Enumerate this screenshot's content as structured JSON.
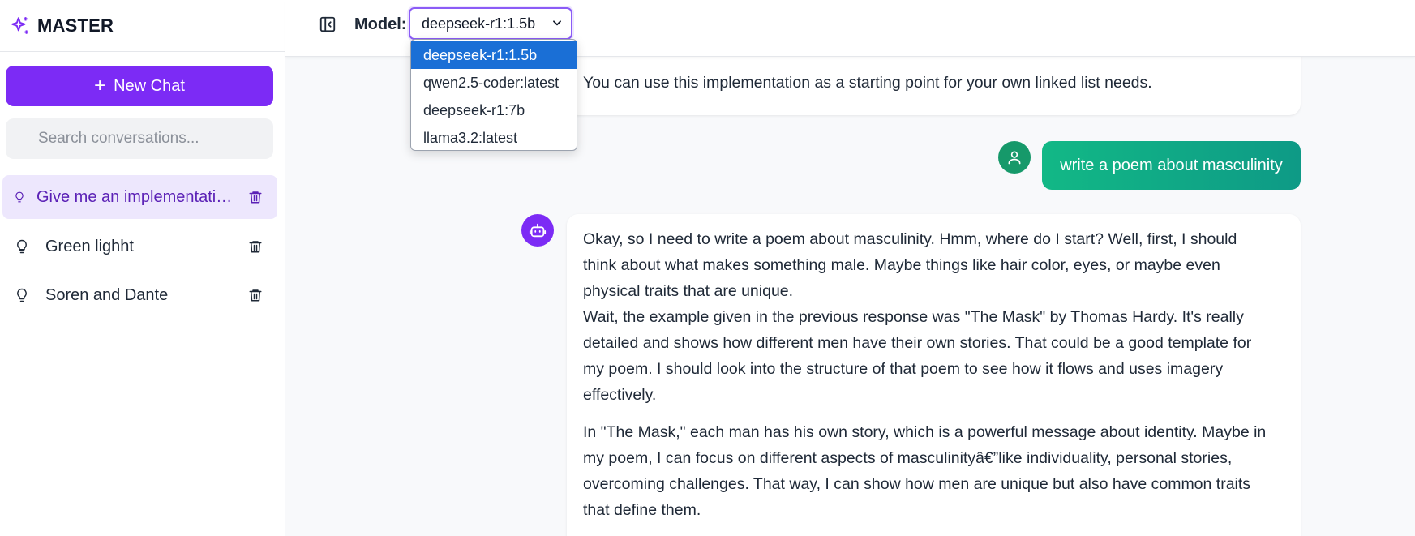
{
  "app": {
    "title": "MASTER",
    "colors": {
      "accent": "#7c2bf5",
      "user_bubble": "#12b886",
      "selected_option": "#1a6fd6"
    }
  },
  "sidebar": {
    "new_chat_label": "New Chat",
    "search_placeholder": "Search conversations...",
    "conversations": [
      {
        "label": "Give me an implementation of a linked list",
        "icon": "lightbulb-icon",
        "active": true
      },
      {
        "label": "Green lighht",
        "icon": "lightbulb-icon",
        "active": false
      },
      {
        "label": "Soren and Dante",
        "icon": "lightbulb-icon",
        "active": false
      }
    ]
  },
  "header": {
    "model_label": "Model:",
    "selected_model": "deepseek-r1:1.5b",
    "model_options": [
      "deepseek-r1:1.5b",
      "qwen2.5-coder:latest",
      "deepseek-r1:7b",
      "llama3.2:latest"
    ]
  },
  "chat": {
    "previous_reply_tail": "You can use this implementation as a starting point for your own linked list needs.",
    "user_message": "write a poem about masculinity",
    "assistant_reply": [
      "Okay, so I need to write a poem about masculinity. Hmm, where do I start? Well, first, I should",
      "think about what makes something male. Maybe things like hair color, eyes, or maybe even",
      "physical traits that are unique.",
      "Wait, the example given in the previous response was \"The Mask\" by Thomas Hardy. It's really",
      "detailed and shows how different men have their own stories. That could be a good template for",
      "my poem. I should look into the structure of that poem to see how it flows and uses imagery",
      "effectively.",
      "In \"The Mask,\" each man has his own story, which is a powerful message about identity. Maybe in",
      "my poem, I can focus on different aspects of masculinityâ€”like individuality, personal stories,",
      "overcoming challenges. That way, I can show how men are unique but also have common traits",
      "that define them."
    ]
  }
}
